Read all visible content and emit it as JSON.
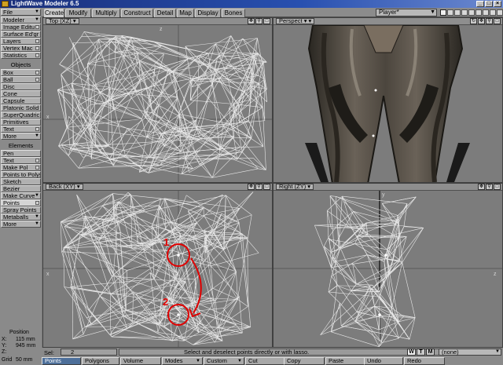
{
  "window": {
    "title": "LightWave Modeler 6.5"
  },
  "tabs": [
    "Create",
    "Modify",
    "Multiply",
    "Construct",
    "Detail",
    "Map",
    "Display",
    "Bones"
  ],
  "active_tab": "Create",
  "player_select": "Player*",
  "sidebar": {
    "file": "File",
    "modeler": "Modeler",
    "image_editor": "Image Editu",
    "surface_editor": "Surface Ed'gr",
    "layers": "Layers",
    "vertex_maps": "Vertex Mac",
    "statistics": "Statistics",
    "objects_header": "Objects",
    "objects": [
      "Box",
      "Ball",
      "Disc",
      "Cone",
      "Capsule",
      "Platonic Solid",
      "SuperQuadric",
      "Primitives",
      "Text",
      "More"
    ],
    "elements_header": "Elements",
    "elements": [
      "Pen",
      "Text",
      "Make Pol",
      "Points to Polys",
      "Sketch",
      "Bezier",
      "Make Curve",
      "Points",
      "Spray Points",
      "Metaballs",
      "More"
    ]
  },
  "position": {
    "header": "Position",
    "x_label": "X:",
    "x_value": "115 mm",
    "y_label": "Y:",
    "y_value": "945 mm",
    "z_label": "Z:",
    "z_value": "",
    "grid_label": "Grid",
    "grid_value": "50 mm"
  },
  "viewports": {
    "top": {
      "label": "Top",
      "axes": "(XZ)"
    },
    "perspective": {
      "label": "Perspect"
    },
    "back": {
      "label": "Back",
      "axes": "(XY)"
    },
    "right": {
      "label": "Right",
      "axes": "(ZY)"
    }
  },
  "axis_letters": {
    "z": "z",
    "x": "x",
    "y": "y"
  },
  "annotations": {
    "one": "1",
    "two": "2"
  },
  "status": {
    "sel_label": "Sel:",
    "sel_count": "2",
    "help_text": "Select and deselect points directly or with lasso.",
    "wtm": [
      "W",
      "T",
      "M"
    ],
    "surface": "(none)"
  },
  "mode_buttons": [
    "Points",
    "Polygons",
    "Volume",
    "Modes",
    "Custom",
    "Cut",
    "Copy",
    "Paste",
    "Undo",
    "Redo"
  ],
  "colors": {
    "wire": "#e8e8e8",
    "annotation": "#e00000",
    "active_mode": "#4d6f9a",
    "title_bar": "#1a2f7a"
  }
}
